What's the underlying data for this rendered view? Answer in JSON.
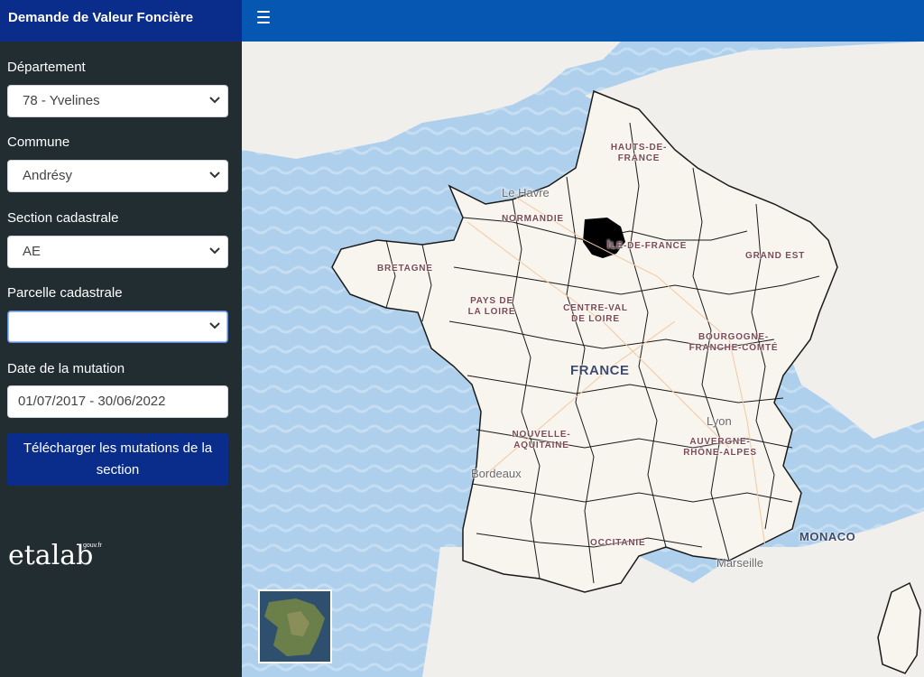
{
  "header": {
    "title": "Demande de Valeur Foncière"
  },
  "sidebar": {
    "fields": [
      {
        "label": "Département",
        "value": "78 - Yvelines"
      },
      {
        "label": "Commune",
        "value": "Andrésy"
      },
      {
        "label": "Section cadastrale",
        "value": "AE"
      },
      {
        "label": "Parcelle cadastrale",
        "value": ""
      },
      {
        "label": "Date de la mutation",
        "value": "01/07/2017 - 30/06/2022"
      }
    ],
    "download_label": "Télécharger les mutations de la section",
    "logo_text": "etalab",
    "logo_sub": "gouv.fr"
  },
  "map": {
    "regions": [
      "HAUTS-DE-FRANCE",
      "NORMANDIE",
      "ÎLE-DE-FRANCE",
      "GRAND EST",
      "BRETAGNE",
      "PAYS DE LA LOIRE",
      "CENTRE-VAL DE LOIRE",
      "BOURGOGNE-FRANCHE-COMTÉ",
      "NOUVELLE-AQUITAINE",
      "AUVERGNE-RHÔNE-ALPES",
      "OCCITANIE"
    ],
    "cities": [
      "Le Havre",
      "Bordeaux",
      "Lyon",
      "Marseille"
    ],
    "country": "FRANCE",
    "monaco": "MONACO",
    "colors": {
      "sea": "#aed0ec",
      "land": "#f8f4ee",
      "selected": "#000000"
    }
  }
}
